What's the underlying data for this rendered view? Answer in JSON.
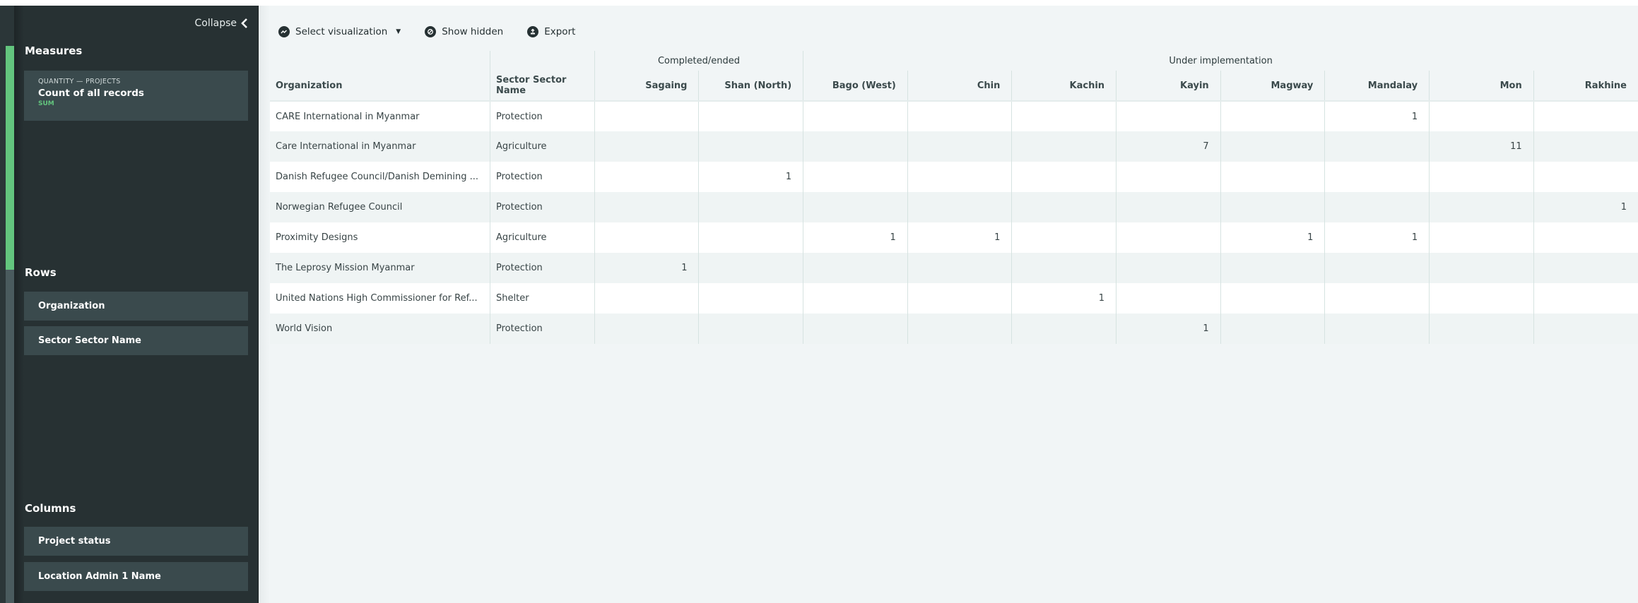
{
  "sidebar": {
    "collapse_label": "Collapse",
    "measures": {
      "title": "Measures",
      "items": [
        {
          "kicker": "QUANTITY — PROJECTS",
          "name": "Count of all records",
          "aggregation": "SUM"
        }
      ]
    },
    "rows": {
      "title": "Rows",
      "items": [
        {
          "label": "Organization"
        },
        {
          "label": "Sector Sector Name"
        }
      ]
    },
    "columns": {
      "title": "Columns",
      "items": [
        {
          "label": "Project status"
        },
        {
          "label": "Location Admin 1 Name"
        }
      ]
    }
  },
  "toolbar": {
    "select_visualization": "Select visualization",
    "show_hidden": "Show hidden",
    "export": "Export"
  },
  "table": {
    "row_headers": [
      "Organization",
      "Sector Sector Name"
    ],
    "column_groups": [
      {
        "label": "Completed/ended",
        "columns": [
          "Sagaing",
          "Shan (North)"
        ]
      },
      {
        "label": "Under implementation",
        "columns": [
          "Bago (West)",
          "Chin",
          "Kachin",
          "Kayin",
          "Magway",
          "Mandalay",
          "Mon",
          "Rakhine"
        ]
      }
    ],
    "rows": [
      {
        "organization": "CARE International in Myanmar",
        "sector": "Protection",
        "values": [
          "",
          "",
          "",
          "",
          "",
          "",
          "",
          "1",
          "",
          ""
        ]
      },
      {
        "organization": "Care International in Myanmar",
        "sector": "Agriculture",
        "values": [
          "",
          "",
          "",
          "",
          "",
          "7",
          "",
          "",
          "11",
          ""
        ]
      },
      {
        "organization": "Danish Refugee Council/Danish Demining ...",
        "sector": "Protection",
        "values": [
          "",
          "1",
          "",
          "",
          "",
          "",
          "",
          "",
          "",
          ""
        ]
      },
      {
        "organization": "Norwegian Refugee Council",
        "sector": "Protection",
        "values": [
          "",
          "",
          "",
          "",
          "",
          "",
          "",
          "",
          "",
          "1"
        ]
      },
      {
        "organization": "Proximity Designs",
        "sector": "Agriculture",
        "values": [
          "",
          "",
          "1",
          "1",
          "",
          "",
          "1",
          "1",
          "",
          ""
        ]
      },
      {
        "organization": "The Leprosy Mission Myanmar",
        "sector": "Protection",
        "values": [
          "1",
          "",
          "",
          "",
          "",
          "",
          "",
          "",
          "",
          ""
        ]
      },
      {
        "organization": "United Nations High Commissioner for Ref...",
        "sector": "Shelter",
        "values": [
          "",
          "",
          "",
          "",
          "1",
          "",
          "",
          "",
          "",
          ""
        ]
      },
      {
        "organization": "World Vision",
        "sector": "Protection",
        "values": [
          "",
          "",
          "",
          "",
          "",
          "1",
          "",
          "",
          "",
          ""
        ]
      }
    ]
  },
  "colors": {
    "sidebar_bg": "#273133",
    "accent_green": "#63c57e",
    "main_bg": "#f1f5f6"
  }
}
